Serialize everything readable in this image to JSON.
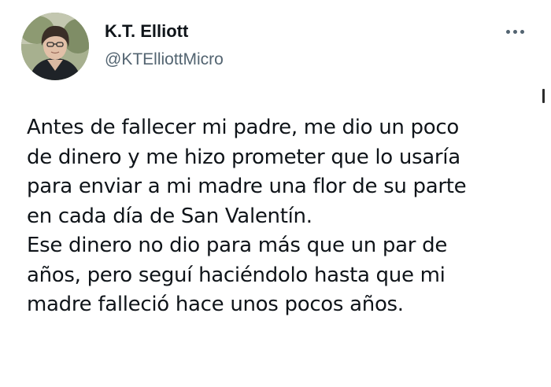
{
  "author": {
    "display_name": "K.T. Elliott",
    "handle": "@KTElliottMicro"
  },
  "more_icon": "more-horizontal-icon",
  "tweet": {
    "lines": [
      "Antes de fallecer mi padre, me dio un poco",
      "de dinero y me hizo prometer que lo usaría",
      "para enviar a mi madre una flor de su parte",
      "en cada día de San Valentín.",
      "Ese dinero no dio para más que un par de",
      "años, pero seguí haciéndolo hasta que mi",
      "madre falleció hace unos pocos años."
    ]
  },
  "colors": {
    "text_primary": "#0f1419",
    "text_secondary": "#536471",
    "background": "#ffffff"
  }
}
